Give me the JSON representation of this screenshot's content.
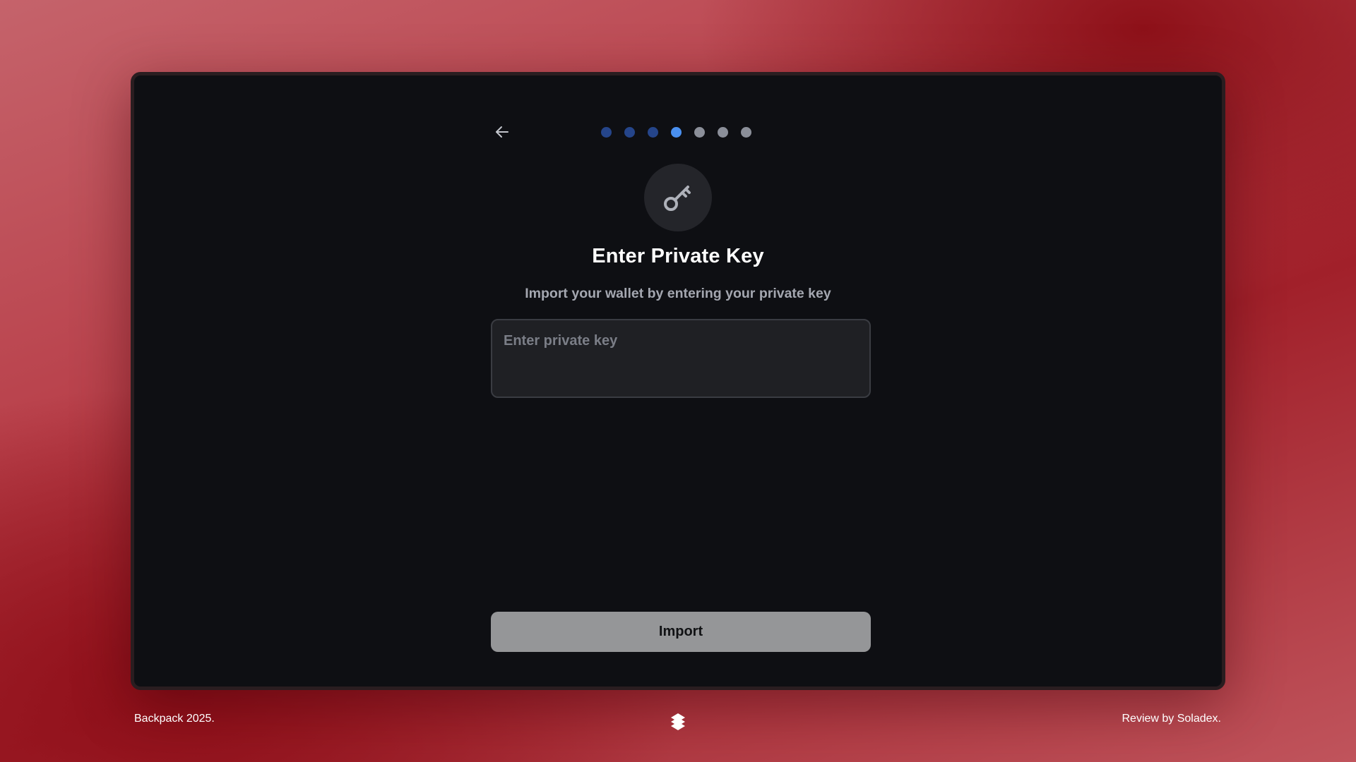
{
  "header": {
    "back_icon": "arrow-left-icon",
    "steps": {
      "total": 7,
      "current": 4,
      "states": [
        "done",
        "done",
        "done",
        "active",
        "todo",
        "todo",
        "todo"
      ]
    }
  },
  "main": {
    "icon": "key-icon",
    "title": "Enter Private Key",
    "subtitle": "Import your wallet by entering your private key",
    "private_key_input": {
      "value": "",
      "placeholder": "Enter private key"
    },
    "import_label": "Import"
  },
  "footer": {
    "left_text": "Backpack 2025.",
    "right_text": "Review by Soladex.",
    "logo_icon": "backpack-logo-icon"
  },
  "colors": {
    "window_bg": "#0e0f13",
    "step_done": "#25458a",
    "step_active": "#4a90f0",
    "step_todo": "#8b8f99",
    "button_bg": "#959698",
    "background_red": "#a1202a"
  }
}
